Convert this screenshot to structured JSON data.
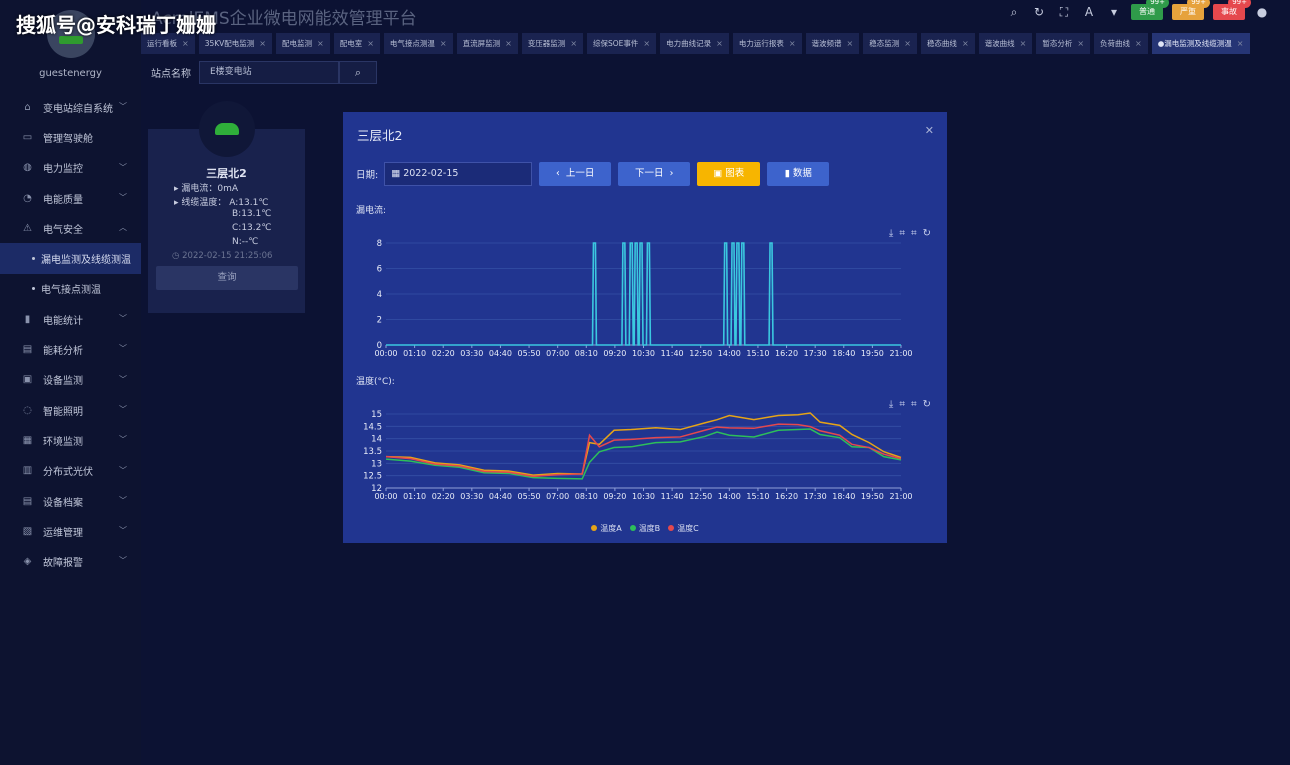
{
  "watermark": "搜狐号@安科瑞丁姗姗",
  "app": {
    "title": "AcrelEMS企业微电网能效管理平台",
    "username": "guestenergy"
  },
  "top_icons": [
    "search-icon",
    "refresh-icon",
    "fullscreen-icon",
    "font-icon",
    "shirt-icon"
  ],
  "badges": [
    {
      "label": "普通",
      "count": "99+",
      "color": "#2f9b4a"
    },
    {
      "label": "严重",
      "count": "99+",
      "color": "#e6a23c"
    },
    {
      "label": "事故",
      "count": "99+",
      "color": "#e5484d"
    }
  ],
  "sidebar": {
    "items": [
      {
        "label": "变电站综自系统",
        "icon": "home-icon",
        "chev": true
      },
      {
        "label": "管理驾驶舱",
        "icon": "monitor-icon",
        "chev": false
      },
      {
        "label": "电力监控",
        "icon": "power-icon",
        "chev": true
      },
      {
        "label": "电能质量",
        "icon": "quality-icon",
        "chev": true
      },
      {
        "label": "电气安全",
        "icon": "alarm-icon",
        "chev": true,
        "expanded": true,
        "children": [
          {
            "label": "漏电监测及线缆测温",
            "active": true
          },
          {
            "label": "电气接点测温",
            "active": false
          }
        ]
      },
      {
        "label": "电能统计",
        "icon": "bar-icon",
        "chev": true
      },
      {
        "label": "能耗分析",
        "icon": "analysis-icon",
        "chev": true
      },
      {
        "label": "设备监测",
        "icon": "device-icon",
        "chev": true
      },
      {
        "label": "智能照明",
        "icon": "bulb-icon",
        "chev": true
      },
      {
        "label": "环境监测",
        "icon": "env-icon",
        "chev": true
      },
      {
        "label": "分布式光伏",
        "icon": "solar-icon",
        "chev": true
      },
      {
        "label": "设备档案",
        "icon": "archive-icon",
        "chev": true
      },
      {
        "label": "运维管理",
        "icon": "ops-icon",
        "chev": true
      },
      {
        "label": "故障报警",
        "icon": "fault-icon",
        "chev": true
      }
    ]
  },
  "tabs": [
    "运行看板",
    "35KV配电监测",
    "配电监测",
    "配电室",
    "电气接点测温",
    "直流屏监测",
    "变压器监测",
    "综保SOE事件",
    "电力曲线记录",
    "电力运行报表",
    "谐波频谱",
    "稳态监测",
    "稳态曲线",
    "谐波曲线",
    "暂态分析",
    "负荷曲线",
    "漏电监测及线缆测温"
  ],
  "toolbar": {
    "label": "站点名称",
    "value": "E楼变电站"
  },
  "card": {
    "name": "三层北2",
    "leak_label": "漏电流：",
    "leak_value": "0mA",
    "temp_label": "线缆温度：",
    "temp_a": "A:13.1℃",
    "temp_b": "B:13.1℃",
    "temp_c": "C:13.2℃",
    "temp_n": "N:--℃",
    "timestamp": "2022-02-15 21:25:06",
    "query": "查询"
  },
  "modal": {
    "title": "三层北2",
    "date_label": "日期:",
    "date": "2022-02-15",
    "prev": "上一日",
    "next": "下一日",
    "chart_btn": "图表",
    "data_btn": "数据"
  },
  "chart_data": [
    {
      "type": "line",
      "title": "漏电流:",
      "x": [
        "00:00",
        "01:10",
        "02:20",
        "03:30",
        "04:40",
        "05:50",
        "07:00",
        "08:10",
        "09:20",
        "10:30",
        "11:40",
        "12:50",
        "14:00",
        "15:10",
        "16:20",
        "17:30",
        "18:40",
        "19:50",
        "21:00"
      ],
      "ylim": [
        0,
        8
      ],
      "yticks": [
        0,
        2,
        4,
        6,
        8
      ],
      "color": "#3bc8e0",
      "spikes_hours": [
        8.5,
        9.7,
        10.0,
        10.2,
        10.4,
        10.7,
        13.85,
        14.15,
        14.35,
        14.55,
        15.7
      ],
      "spike_value": 8,
      "baseline": 0,
      "x_hours_max": 21.0
    },
    {
      "type": "line",
      "title": "温度(°C):",
      "x": [
        "00:00",
        "01:10",
        "02:20",
        "03:30",
        "04:40",
        "05:50",
        "07:00",
        "08:10",
        "09:20",
        "10:30",
        "11:40",
        "12:50",
        "14:00",
        "15:10",
        "16:20",
        "17:30",
        "18:40",
        "19:50",
        "21:00"
      ],
      "ylim": [
        12,
        15
      ],
      "yticks": [
        12,
        12.5,
        13,
        13.5,
        14,
        14.5,
        15
      ],
      "series": [
        {
          "name": "温度A",
          "color": "#e6a417",
          "points": [
            [
              0,
              13.3
            ],
            [
              1,
              13.2
            ],
            [
              2,
              13.05
            ],
            [
              3,
              12.9
            ],
            [
              4,
              12.75
            ],
            [
              5,
              12.65
            ],
            [
              6,
              12.55
            ],
            [
              7,
              12.55
            ],
            [
              8,
              12.6
            ],
            [
              8.3,
              13.8
            ],
            [
              8.7,
              13.8
            ],
            [
              9.3,
              14.3
            ],
            [
              10,
              14.4
            ],
            [
              11,
              14.4
            ],
            [
              12,
              14.4
            ],
            [
              13,
              14.6
            ],
            [
              13.5,
              14.8
            ],
            [
              14,
              14.9
            ],
            [
              15,
              14.8
            ],
            [
              16,
              14.9
            ],
            [
              16.8,
              15.0
            ],
            [
              17.3,
              15.0
            ],
            [
              17.7,
              14.7
            ],
            [
              18.5,
              14.5
            ],
            [
              19,
              14.2
            ],
            [
              19.7,
              13.8
            ],
            [
              20.3,
              13.5
            ],
            [
              21,
              13.2
            ]
          ]
        },
        {
          "name": "温度B",
          "color": "#2dbf5a",
          "points": [
            [
              0,
              13.2
            ],
            [
              1,
              13.05
            ],
            [
              2,
              12.95
            ],
            [
              3,
              12.8
            ],
            [
              4,
              12.65
            ],
            [
              5,
              12.55
            ],
            [
              6,
              12.45
            ],
            [
              7,
              12.35
            ],
            [
              8,
              12.4
            ],
            [
              8.3,
              13.0
            ],
            [
              8.7,
              13.5
            ],
            [
              9.3,
              13.6
            ],
            [
              10,
              13.7
            ],
            [
              11,
              13.8
            ],
            [
              12,
              13.9
            ],
            [
              13,
              14.05
            ],
            [
              13.5,
              14.3
            ],
            [
              14,
              14.1
            ],
            [
              15,
              14.1
            ],
            [
              16,
              14.3
            ],
            [
              16.8,
              14.4
            ],
            [
              17.3,
              14.35
            ],
            [
              17.7,
              14.2
            ],
            [
              18.5,
              14.0
            ],
            [
              19,
              13.7
            ],
            [
              19.7,
              13.6
            ],
            [
              20.3,
              13.3
            ],
            [
              21,
              13.1
            ]
          ]
        },
        {
          "name": "温度C",
          "color": "#e5484d",
          "points": [
            [
              0,
              13.3
            ],
            [
              1,
              13.15
            ],
            [
              2,
              13.0
            ],
            [
              3,
              12.85
            ],
            [
              4,
              12.7
            ],
            [
              5,
              12.6
            ],
            [
              6,
              12.5
            ],
            [
              7,
              12.5
            ],
            [
              8,
              12.6
            ],
            [
              8.3,
              14.1
            ],
            [
              8.7,
              13.7
            ],
            [
              9.3,
              13.9
            ],
            [
              10,
              14.0
            ],
            [
              11,
              14.0
            ],
            [
              12,
              14.1
            ],
            [
              13,
              14.3
            ],
            [
              13.5,
              14.5
            ],
            [
              14,
              14.4
            ],
            [
              15,
              14.45
            ],
            [
              16,
              14.55
            ],
            [
              16.8,
              14.6
            ],
            [
              17.3,
              14.45
            ],
            [
              17.7,
              14.35
            ],
            [
              18.5,
              14.1
            ],
            [
              19,
              13.8
            ],
            [
              19.7,
              13.6
            ],
            [
              20.3,
              13.4
            ],
            [
              21,
              13.15
            ]
          ]
        }
      ],
      "x_hours_max": 21.0,
      "legend": "bottom"
    }
  ]
}
